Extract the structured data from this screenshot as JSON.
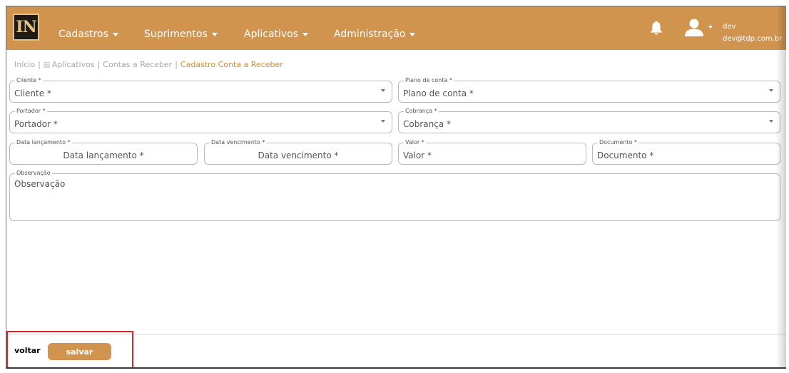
{
  "nav": {
    "logo_text": "IN",
    "menu": [
      "Cadastros",
      "Suprimentos",
      "Aplicativos",
      "Administração"
    ],
    "user_name": "dev",
    "user_email": "dev@tdp.com.br"
  },
  "breadcrumb": {
    "items": [
      "Início",
      "Aplicativos",
      "Contas a Receber"
    ],
    "current": "Cadastro Conta a Receber",
    "separator": "|"
  },
  "form": {
    "cliente": {
      "label": "Cliente *",
      "placeholder": "Cliente *"
    },
    "plano_conta": {
      "label": "Plano de conta *",
      "placeholder": "Plano de conta *"
    },
    "portador": {
      "label": "Portador *",
      "placeholder": "Portador *"
    },
    "cobranca": {
      "label": "Cobrança *",
      "placeholder": "Cobrança *"
    },
    "data_lancamento": {
      "label": "Data lançamento *",
      "placeholder": "Data lançamento *"
    },
    "data_vencimento": {
      "label": "Data vencimento *",
      "placeholder": "Data vencimento *"
    },
    "valor": {
      "label": "Valor *",
      "placeholder": "Valor *"
    },
    "documento": {
      "label": "Documento *",
      "placeholder": "Documento *"
    },
    "observacao": {
      "label": "Observação",
      "placeholder": "Observação"
    }
  },
  "footer": {
    "back_label": "voltar",
    "save_label": "salvar"
  },
  "colors": {
    "navbar": "#d0944f",
    "accent": "#c98f3f",
    "highlight_border": "#e0242b"
  }
}
